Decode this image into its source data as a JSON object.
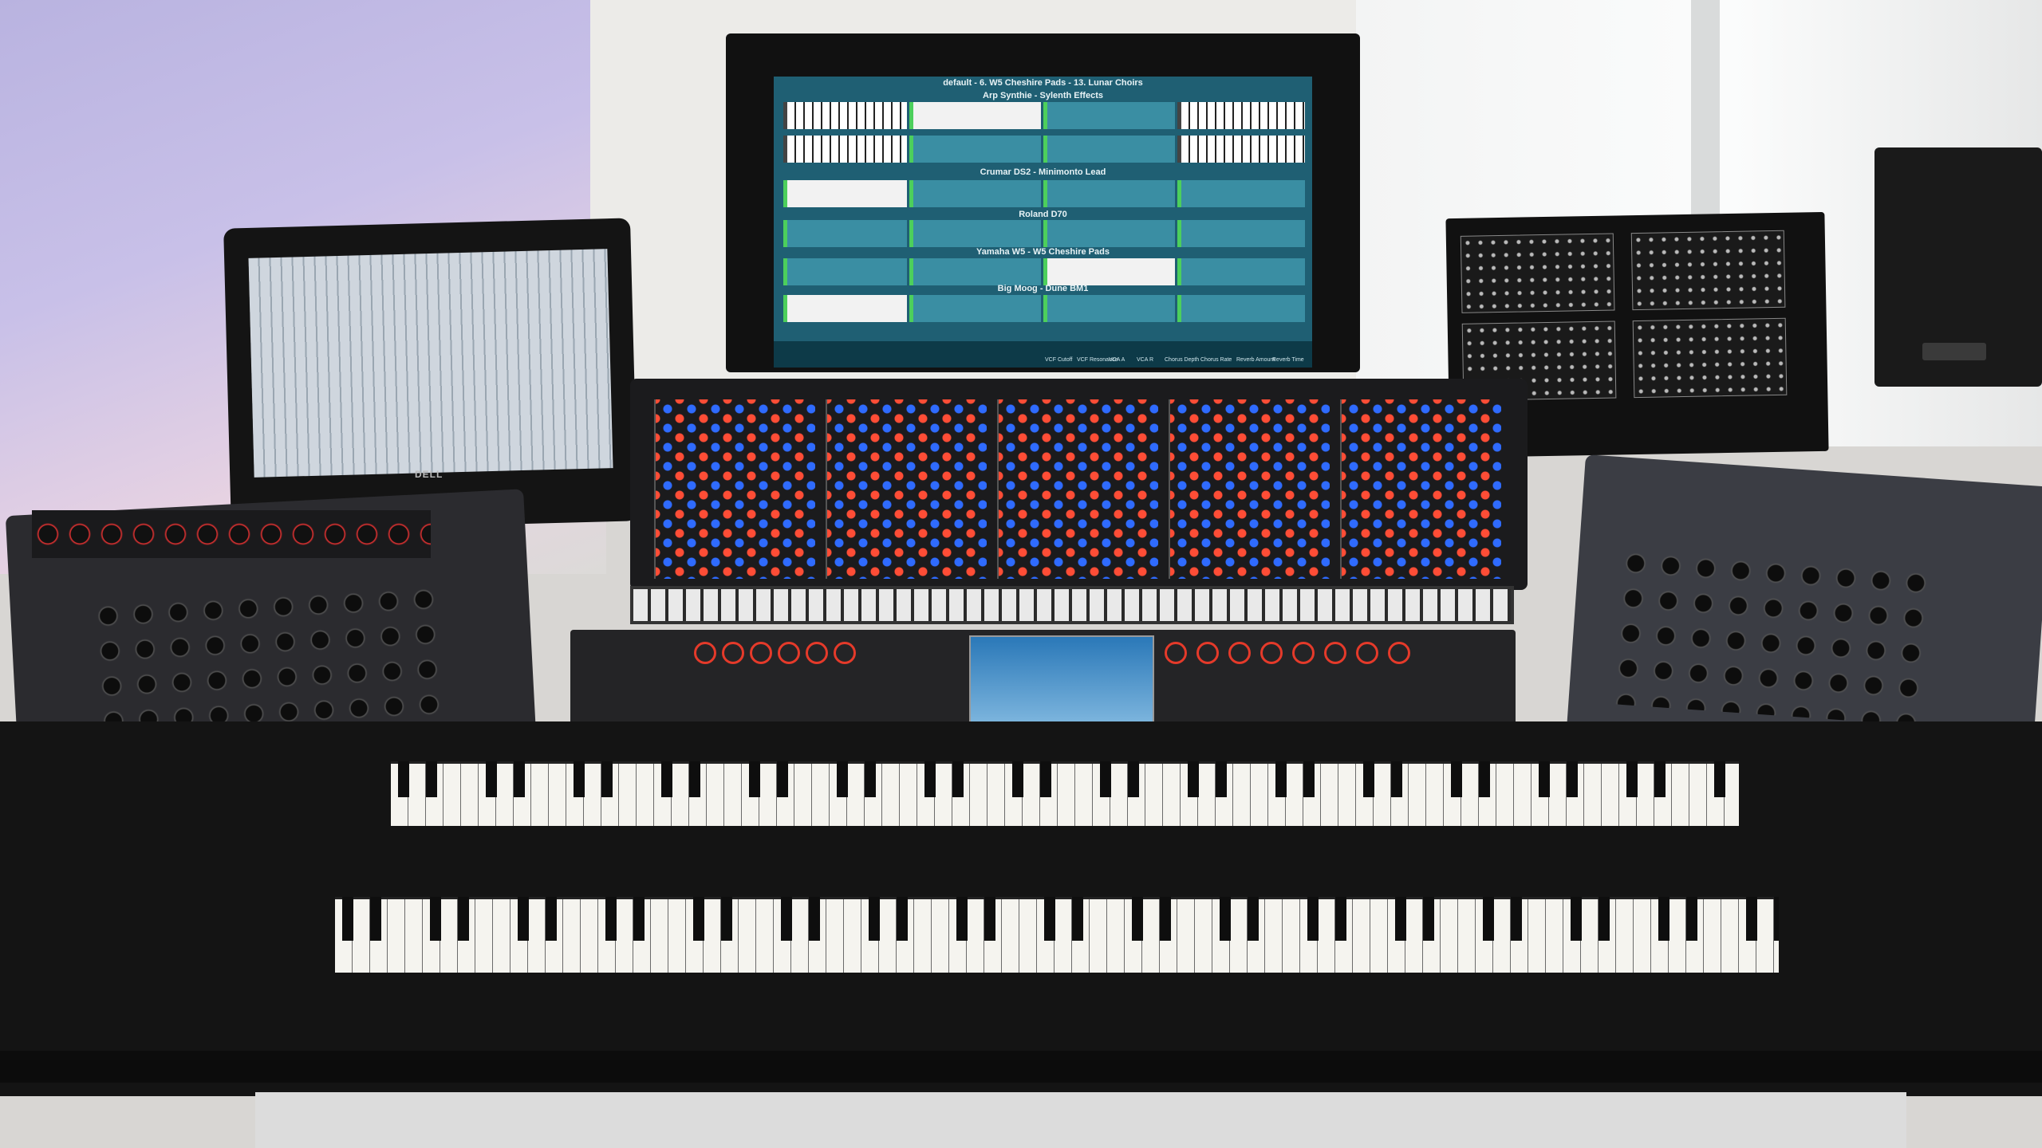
{
  "scene": {
    "description_tags": [
      "keyboard-rig",
      "organ",
      "controllers",
      "monitor"
    ]
  },
  "main_screen": {
    "header": "default - 6. W5 Cheshire Pads  -  13. Lunar Choirs",
    "sections": [
      "Arp Synthie - Sylenth Effects",
      "Crumar DS2 - Minimonto Lead",
      "Roland D70",
      "Yamaha W5 - W5 Cheshire Pads",
      "Big Moog - Dune BM1"
    ],
    "knob_labels": [
      "VCF Cutoff",
      "VCF Resonance",
      "VCA A",
      "VCA R",
      "Chorus Depth",
      "Chorus Rate",
      "Reverb Amount",
      "Reverb Time"
    ]
  },
  "laptop": {
    "brand": "DELL"
  }
}
